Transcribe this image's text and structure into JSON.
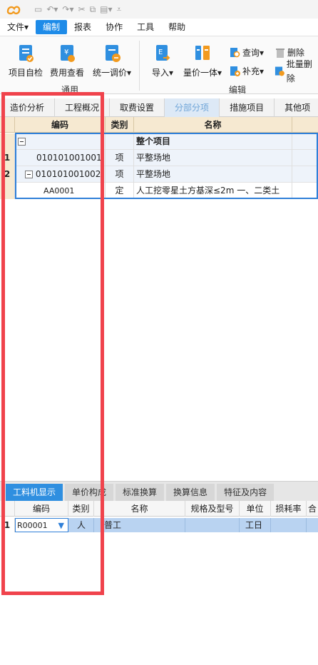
{
  "menu": [
    "文件▾",
    "编制",
    "报表",
    "协作",
    "工具",
    "帮助"
  ],
  "ribbon": {
    "buttons": [
      "项目自检",
      "费用查看",
      "统一调价▾",
      "导入▾",
      "量价一体▾"
    ],
    "small": [
      "查询▾",
      "删除",
      "补充▾",
      "批量删除"
    ],
    "group_general": "通用",
    "group_edit": "编辑"
  },
  "tabs": [
    "造价分析",
    "工程概况",
    "取费设置",
    "分部分项",
    "措施项目",
    "其他项"
  ],
  "grid": {
    "columns": [
      "编码",
      "类别",
      "名称"
    ],
    "rows": [
      {
        "num": "",
        "code": "",
        "type": "",
        "name": "整个项目"
      },
      {
        "num": "1",
        "code": "010101001001",
        "type": "项",
        "name": "平整场地"
      },
      {
        "num": "2",
        "code": "010101001002",
        "type": "项",
        "name": "平整场地"
      },
      {
        "num": "",
        "code": "AA0001",
        "type": "定",
        "name": "人工挖零星土方基深≤2m 一、二类土"
      }
    ]
  },
  "bottom": {
    "tabs": [
      "工料机显示",
      "单价构成",
      "标准换算",
      "换算信息",
      "特征及内容"
    ],
    "columns": [
      "编码",
      "类别",
      "名称",
      "规格及型号",
      "单位",
      "损耗率",
      "合"
    ],
    "row": {
      "num": "1",
      "code": "R00001",
      "type": "人",
      "name": "普工",
      "unit": "工日"
    }
  },
  "colors": {
    "accent": "#1e8be8",
    "highlight": "#f0434c",
    "header": "#f6e9d1"
  }
}
